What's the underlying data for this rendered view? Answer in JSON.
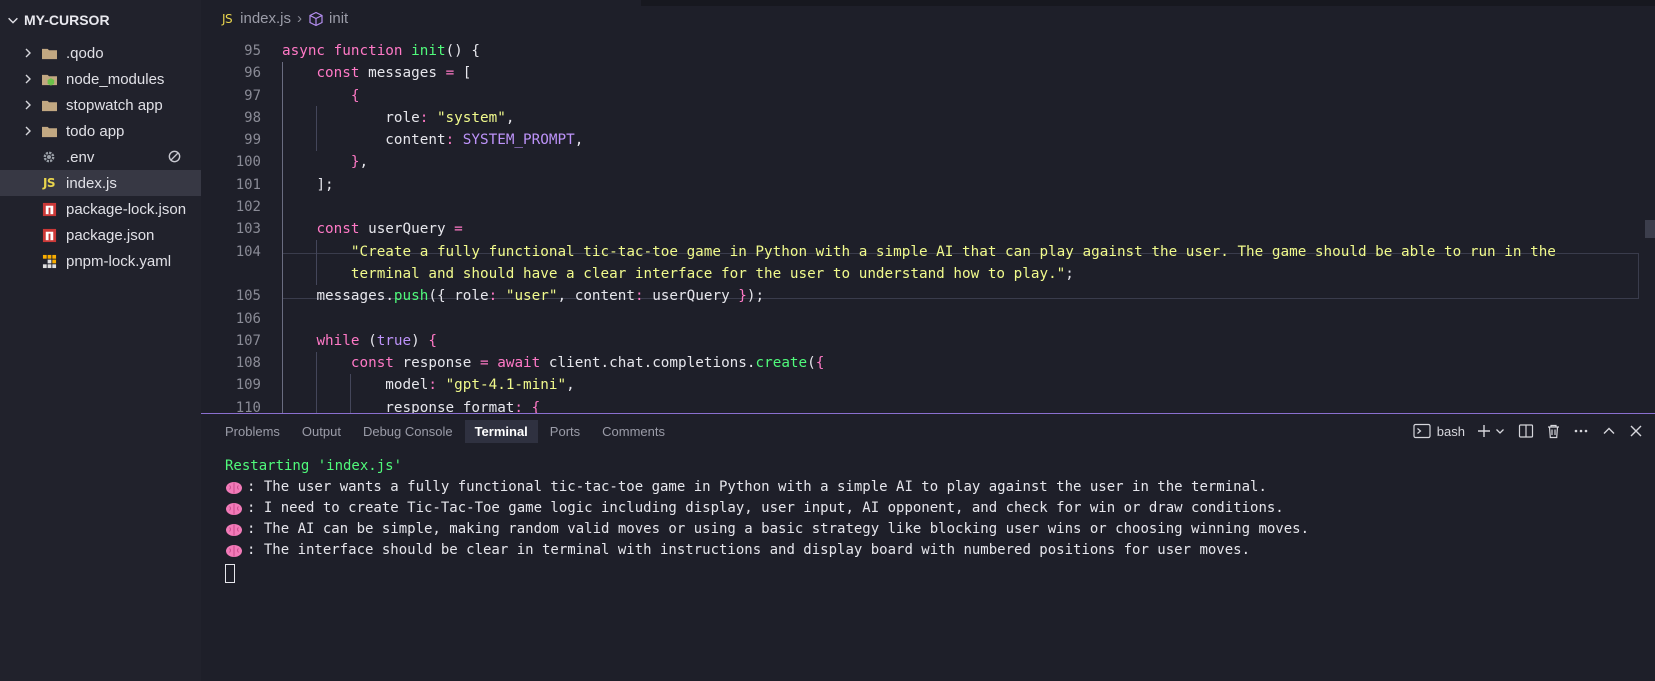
{
  "explorer": {
    "title": "MY-CURSOR",
    "items": [
      {
        "label": ".qodo",
        "type": "folder",
        "expandable": true
      },
      {
        "label": "node_modules",
        "type": "folder-node",
        "expandable": true
      },
      {
        "label": "stopwatch app",
        "type": "folder",
        "expandable": true
      },
      {
        "label": "todo app",
        "type": "folder",
        "expandable": true
      },
      {
        "label": ".env",
        "type": "gear",
        "expandable": false
      },
      {
        "label": "index.js",
        "type": "js",
        "expandable": false,
        "active": true
      },
      {
        "label": "package-lock.json",
        "type": "npm",
        "expandable": false
      },
      {
        "label": "package.json",
        "type": "npm",
        "expandable": false
      },
      {
        "label": "pnpm-lock.yaml",
        "type": "pnpm",
        "expandable": false
      }
    ],
    "js_badge": "JS"
  },
  "breadcrumb": {
    "file": "index.js",
    "symbol": "init",
    "js_badge": "JS"
  },
  "editor": {
    "line_numbers": [
      "95",
      "96",
      "97",
      "98",
      "99",
      "100",
      "101",
      "102",
      "103",
      "104",
      "",
      "105",
      "106",
      "107",
      "108",
      "109",
      "110"
    ]
  },
  "panel": {
    "tabs": [
      "Problems",
      "Output",
      "Debug Console",
      "Terminal",
      "Ports",
      "Comments"
    ],
    "active_tab": "Terminal",
    "shell": "bash"
  },
  "terminal": {
    "restart": "Restarting 'index.js'",
    "lines": [
      ": The user wants a fully functional tic-tac-toe game in Python with a simple AI to play against the user in the terminal.",
      ": I need to create Tic-Tac-Toe game logic including display, user input, AI opponent, and check for win or draw conditions.",
      ": The AI can be simple, making random valid moves or using a basic strategy like blocking user wins or choosing winning moves.",
      ": The interface should be clear in terminal with instructions and display board with numbered positions for user moves."
    ]
  },
  "colors": {
    "keyword": "#ff79c6",
    "function": "#50fa7b",
    "string": "#f1fa8c",
    "constant": "#bd93f9",
    "panel_border": "#8a6fcf"
  }
}
